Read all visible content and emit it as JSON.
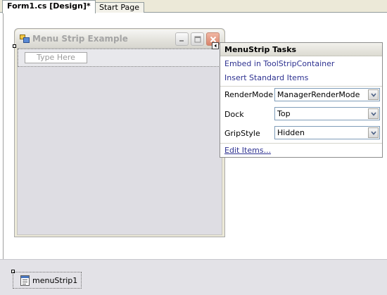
{
  "tabs": [
    {
      "label": "Form1.cs [Design]*",
      "active": true
    },
    {
      "label": "Start Page",
      "active": false
    }
  ],
  "form": {
    "title": "Menu Strip Example",
    "menustrip": {
      "placeholder": "Type Here"
    }
  },
  "tasks_panel": {
    "title": "MenuStrip Tasks",
    "links": {
      "embed": "Embed in ToolStripContainer",
      "insert": "Insert Standard Items",
      "edit": "Edit Items..."
    },
    "properties": [
      {
        "label": "RenderMode",
        "value": "ManagerRenderMode"
      },
      {
        "label": "Dock",
        "value": "Top"
      },
      {
        "label": "GripStyle",
        "value": "Hidden"
      }
    ]
  },
  "component_tray": {
    "items": [
      {
        "label": "menuStrip1",
        "icon": "menustrip-component-icon"
      }
    ]
  },
  "colors": {
    "link": "#2e3291",
    "tray_background": "#e3e2e7",
    "form_client": "#dedde3"
  }
}
